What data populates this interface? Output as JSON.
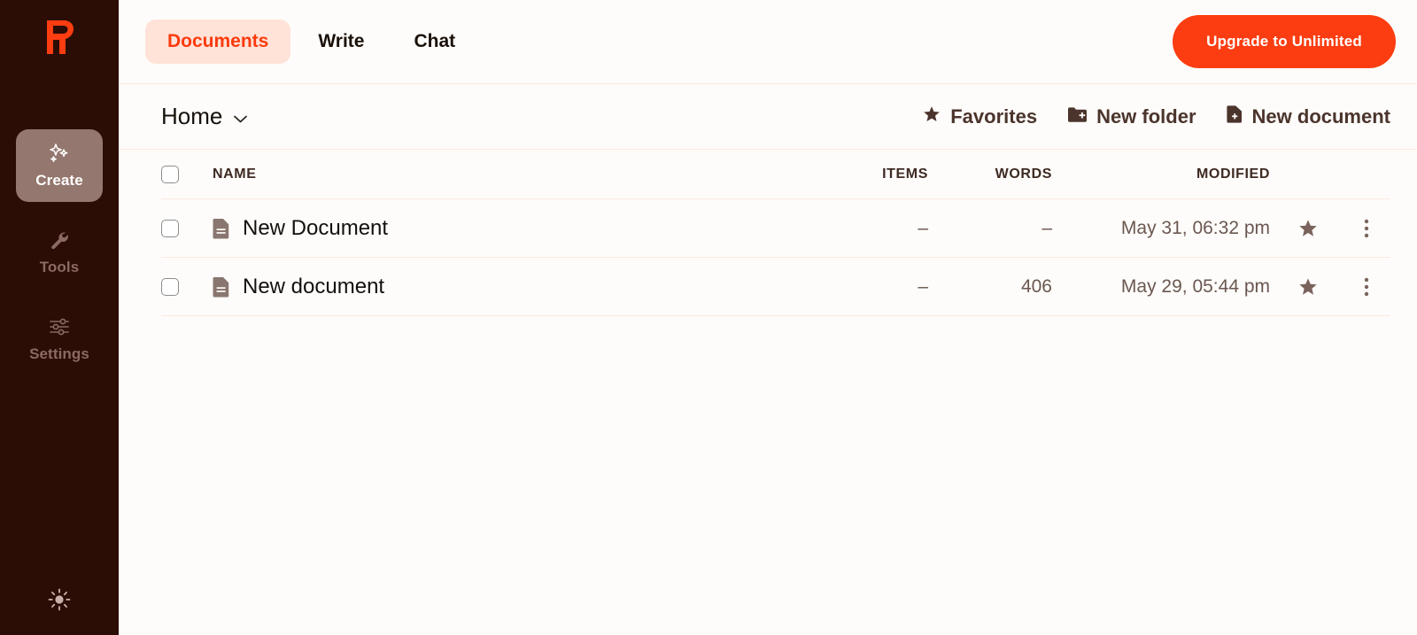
{
  "sidebar": {
    "logo": {
      "icon": "brand-r-logo",
      "color": "#fc3d11"
    },
    "items": [
      {
        "label": "Create",
        "icon": "sparkles-icon",
        "active": true
      },
      {
        "label": "Tools",
        "icon": "wrench-icon",
        "active": false
      },
      {
        "label": "Settings",
        "icon": "sliders-icon",
        "active": false
      }
    ],
    "theme_toggle": {
      "icon": "sun-icon",
      "label": "Light mode"
    }
  },
  "topbar": {
    "tabs": [
      {
        "label": "Documents",
        "active": true
      },
      {
        "label": "Write",
        "active": false
      },
      {
        "label": "Chat",
        "active": false
      }
    ],
    "upgrade_label": "Upgrade to Unlimited"
  },
  "toolbar": {
    "breadcrumb": {
      "label": "Home",
      "icon": "chevron-down-icon"
    },
    "actions": [
      {
        "label": "Favorites",
        "icon": "star-icon"
      },
      {
        "label": "New folder",
        "icon": "folder-plus-icon"
      },
      {
        "label": "New document",
        "icon": "document-plus-icon"
      }
    ]
  },
  "table": {
    "headers": {
      "name": "NAME",
      "items": "ITEMS",
      "words": "WORDS",
      "modified": "MODIFIED"
    },
    "rows": [
      {
        "name": "New Document",
        "items": "–",
        "words": "–",
        "modified": "May 31, 06:32 pm",
        "icon": "document-icon",
        "star": "star-icon",
        "menu": "more-vertical-icon"
      },
      {
        "name": "New document",
        "items": "–",
        "words": "406",
        "modified": "May 29, 05:44 pm",
        "icon": "document-icon",
        "star": "star-icon",
        "menu": "more-vertical-icon"
      }
    ]
  },
  "colors": {
    "brand": "#fc3d11",
    "sidebar_bg": "#2b0d05",
    "active_nav_bg": "#94776e",
    "active_tab_bg": "#ffe3d8",
    "page_bg": "#fdfcfa",
    "divider": "#fbe8e1"
  }
}
